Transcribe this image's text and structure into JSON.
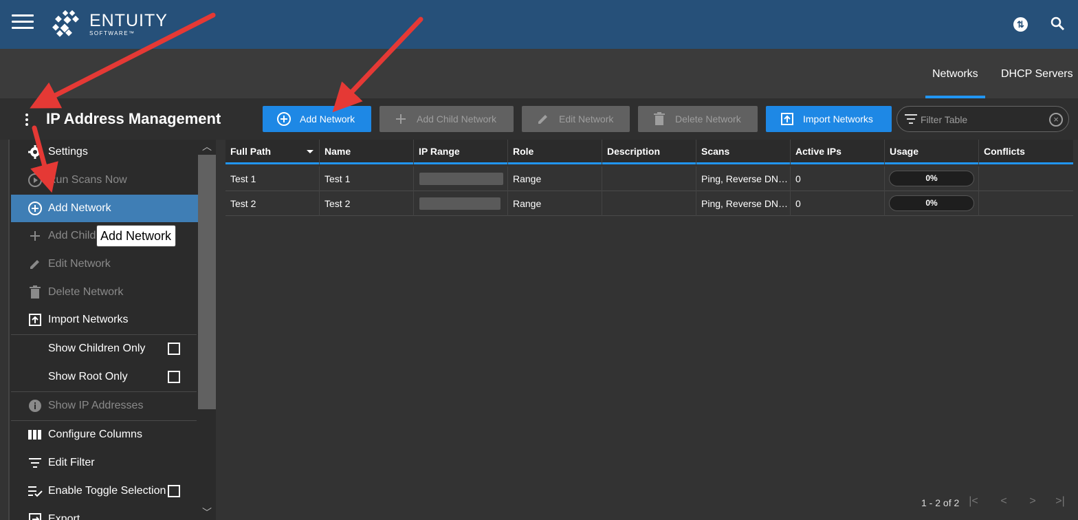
{
  "topbar": {
    "brand_name": "ENTUITY",
    "brand_sub": "SOFTWARE™"
  },
  "tabs": [
    {
      "label": "Networks",
      "active": true
    },
    {
      "label": "DHCP Servers",
      "active": false
    }
  ],
  "page_title": "IP Address Management",
  "toolbar": {
    "add_network": "Add Network",
    "add_child_network": "Add Child Network",
    "edit_network": "Edit Network",
    "delete_network": "Delete Network",
    "import_networks": "Import Networks",
    "filter_placeholder": "Filter Table"
  },
  "menu": {
    "settings": "Settings",
    "run_scans": "Run Scans Now",
    "add_network": "Add Network",
    "add_child": "Add Child",
    "edit_network": "Edit Network",
    "delete_network": "Delete Network",
    "import_networks": "Import Networks",
    "show_children_only": "Show Children Only",
    "show_root_only": "Show Root Only",
    "show_ip_addresses": "Show IP Addresses",
    "configure_columns": "Configure Columns",
    "edit_filter": "Edit Filter",
    "enable_toggle_selection": "Enable Toggle Selection",
    "export": "Export"
  },
  "tooltip": "Add Network",
  "table": {
    "columns": [
      "Full Path",
      "Name",
      "IP Range",
      "Role",
      "Description",
      "Scans",
      "Active IPs",
      "Usage",
      "Conflicts"
    ],
    "rows": [
      {
        "full_path": "Test 1",
        "name": "Test 1",
        "role": "Range",
        "description": "",
        "scans": "Ping, Reverse DN…",
        "active_ips": "0",
        "usage": "0%",
        "conflicts": ""
      },
      {
        "full_path": "Test 2",
        "name": "Test 2",
        "role": "Range",
        "description": "",
        "scans": "Ping, Reverse DN…",
        "active_ips": "0",
        "usage": "0%",
        "conflicts": ""
      }
    ]
  },
  "pager": {
    "text": "1 - 2 of 2"
  },
  "colors": {
    "topbar": "#265079",
    "accent": "#2196f3",
    "primary_button": "#1e88e5",
    "annotation_arrow": "#e53935"
  }
}
